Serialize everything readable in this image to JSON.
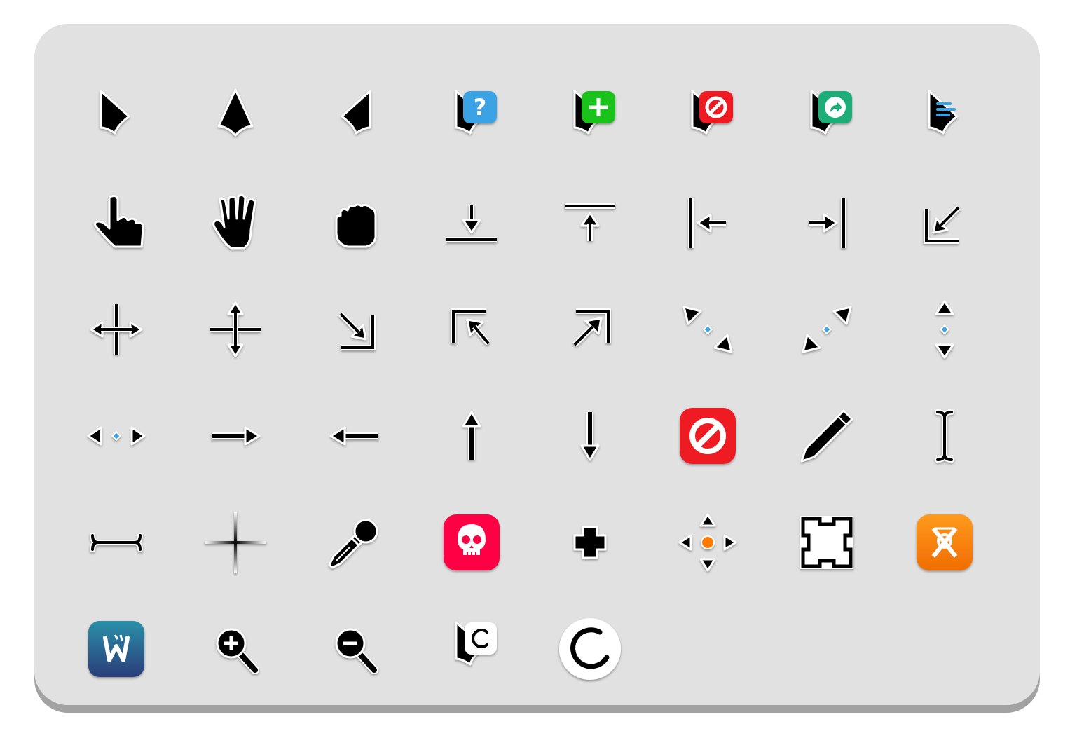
{
  "sheet": {
    "background_color": "#e1e1e1",
    "shadow_color": "#a2a2a2"
  },
  "colors": {
    "help_blue": "#3aa3e3",
    "copy_green": "#1fc21f",
    "alias_teal": "#1cad78",
    "progress_blue": "#3aa3e3",
    "no_drop_red": "#ee1c24",
    "pirate_red": "#ff0044",
    "center_orange": "#ff7a00",
    "x_cursor_orange": "#ff7f00",
    "wayland_blue": "#2a6ea0",
    "pointer_black": "#000000",
    "outline_white": "#ffffff"
  },
  "cursors": [
    [
      "default-icon",
      "center-ptr-icon",
      "right-ptr-icon",
      "help-icon",
      "copy-icon",
      "no-drop-icon",
      "alias-icon",
      "progress-icon"
    ],
    [
      "pointer-icon",
      "open-hand-icon",
      "grabbing-icon",
      "bottom-side-icon",
      "top-side-icon",
      "left-side-icon",
      "right-side-icon",
      "bottom-left-corner-icon"
    ],
    [
      "move-icon",
      "size-vertical-icon",
      "bottom-right-corner-icon",
      "top-left-corner-icon",
      "top-right-corner-icon",
      "nwse-resize-icon",
      "nesw-resize-icon",
      "ns-resize-icon"
    ],
    [
      "ew-resize-icon",
      "right-arrow-icon",
      "left-arrow-icon",
      "up-arrow-icon",
      "down-arrow-icon",
      "not-allowed-icon",
      "pencil-icon",
      "text-cursor-icon"
    ],
    [
      "vertical-text-icon",
      "crosshair-icon",
      "color-picker-icon",
      "pirate-icon",
      "plus-icon",
      "all-scroll-icon",
      "dotbox-icon",
      "x-cursor-icon"
    ],
    [
      "wayland-cursor-icon",
      "zoom-in-icon",
      "zoom-out-icon",
      "progress-pointer-icon",
      "wait-icon"
    ]
  ]
}
